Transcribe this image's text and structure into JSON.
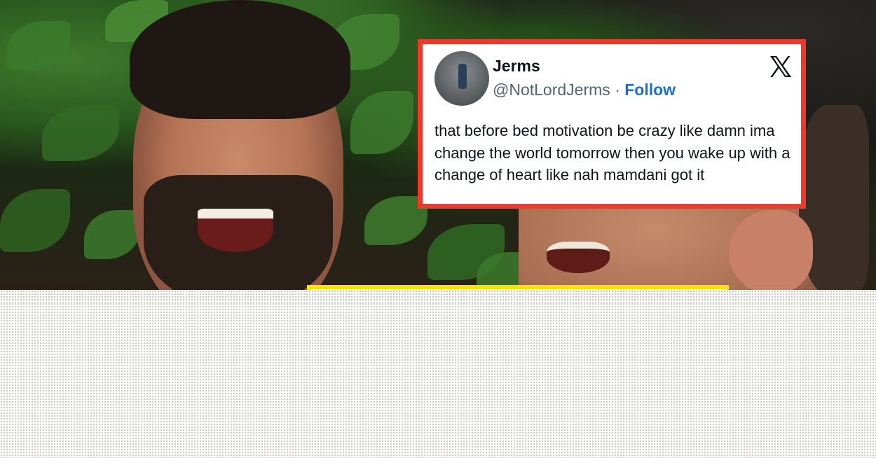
{
  "tweet": {
    "name": "Jerms",
    "handle": "@NotLordJerms",
    "separator": "·",
    "follow_label": "Follow",
    "text": "that before bed motivation be crazy like damn ima change the world tomorrow then you wake up with a change of heart like nah mamdani got it",
    "platform_icon": "x-logo-icon",
    "border_color": "#ee3a2c",
    "follow_color": "#1d6fd1"
  },
  "second_card": {
    "border_color": "#f6e500"
  }
}
